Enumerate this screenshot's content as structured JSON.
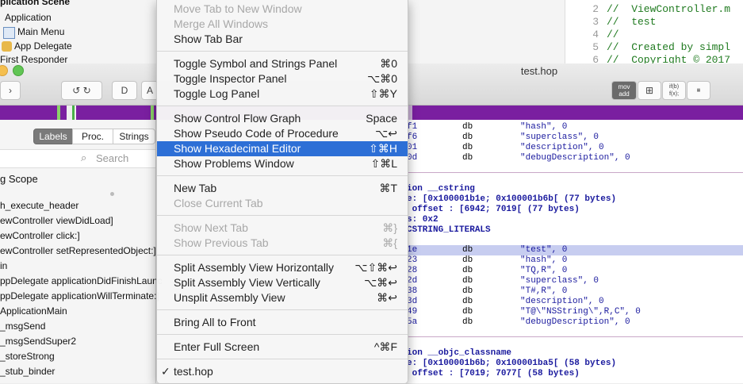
{
  "background": {
    "tree_items": [
      "plication Scene",
      "Application",
      "Main Menu",
      "App Delegate",
      "First Responder"
    ],
    "code_lines": [
      {
        "num": "2",
        "text": "//  ViewController.m"
      },
      {
        "num": "3",
        "text": "//  test"
      },
      {
        "num": "4",
        "text": "//"
      },
      {
        "num": "5",
        "text": "//  Created by simpl"
      },
      {
        "num": "6",
        "text": "//  Copyright © 2017"
      }
    ]
  },
  "hopper": {
    "title": "test.hop",
    "toolbar": {
      "d_label": "D",
      "a_label": "A",
      "mov_label": "mov",
      "add_label": "add",
      "if_label": "if(b)",
      "f_label": "f(x);"
    },
    "tabs": [
      "Labels",
      "Proc.",
      "Strings"
    ],
    "search_placeholder": "Search",
    "scope_title": "g Scope",
    "symbols": [
      "h_execute_header",
      "ewController viewDidLoad]",
      "ewController click:]",
      "ewController setRepresentedObject:]",
      "in",
      "ppDelegate applicationDidFinishLaunc",
      "ppDelegate applicationWillTerminate:]",
      "ApplicationMain",
      "_msgSend",
      "_msgSendSuper2",
      "_storeStrong",
      "_stub_binder"
    ],
    "asm_block1": [
      {
        "a": "f1",
        "b": "db",
        "c": "\"hash\", 0"
      },
      {
        "a": "f6",
        "b": "db",
        "c": "\"superclass\", 0"
      },
      {
        "a": "01",
        "b": "db",
        "c": "\"description\", 0"
      },
      {
        "a": "0d",
        "b": "db",
        "c": "\"debugDescription\", 0"
      }
    ],
    "section1": [
      "ion __cstring",
      "e: [0x100001b1e; 0x100001b6b[ (77 bytes)",
      " offset : [6942; 7019[ (77 bytes)",
      "s: 0x2",
      "CSTRING_LITERALS"
    ],
    "asm_block2": [
      {
        "a": "1e",
        "b": "db",
        "c": "\"test\", 0"
      },
      {
        "a": "23",
        "b": "db",
        "c": "\"hash\", 0"
      },
      {
        "a": "28",
        "b": "db",
        "c": "\"TQ,R\", 0"
      },
      {
        "a": "2d",
        "b": "db",
        "c": "\"superclass\", 0"
      },
      {
        "a": "38",
        "b": "db",
        "c": "\"T#,R\", 0"
      },
      {
        "a": "3d",
        "b": "db",
        "c": "\"description\", 0"
      },
      {
        "a": "49",
        "b": "db",
        "c": "\"T@\\\"NSString\\\",R,C\", 0"
      },
      {
        "a": "5a",
        "b": "db",
        "c": "\"debugDescription\", 0"
      }
    ],
    "section2": [
      "ion __objc_classname",
      "e: [0x100001b6b; 0x100001ba5[ (58 bytes)",
      " offset : [7019; 7077[ (58 bytes)"
    ]
  },
  "menu": {
    "groups": [
      [
        {
          "label": "Move Tab to New Window",
          "shortcut": "",
          "disabled": true
        },
        {
          "label": "Merge All Windows",
          "shortcut": "",
          "disabled": true
        },
        {
          "label": "Show Tab Bar",
          "shortcut": "",
          "disabled": false
        }
      ],
      [
        {
          "label": "Toggle Symbol and Strings Panel",
          "shortcut": "⌘0",
          "disabled": false
        },
        {
          "label": "Toggle Inspector Panel",
          "shortcut": "⌥⌘0",
          "disabled": false
        },
        {
          "label": "Toggle Log Panel",
          "shortcut": "⇧⌘Y",
          "disabled": false
        }
      ],
      [
        {
          "label": "Show Control Flow Graph",
          "shortcut": "Space",
          "disabled": false
        },
        {
          "label": "Show Pseudo Code of Procedure",
          "shortcut": "⌥↩",
          "disabled": false
        },
        {
          "label": "Show Hexadecimal Editor",
          "shortcut": "⇧⌘H",
          "disabled": false,
          "highlighted": true
        },
        {
          "label": "Show Problems Window",
          "shortcut": "⇧⌘L",
          "disabled": false
        }
      ],
      [
        {
          "label": "New Tab",
          "shortcut": "⌘T",
          "disabled": false
        },
        {
          "label": "Close Current Tab",
          "shortcut": "",
          "disabled": true
        }
      ],
      [
        {
          "label": "Show Next Tab",
          "shortcut": "⌘}",
          "disabled": true
        },
        {
          "label": "Show Previous Tab",
          "shortcut": "⌘{",
          "disabled": true
        }
      ],
      [
        {
          "label": "Split Assembly View Horizontally",
          "shortcut": "⌥⇧⌘↩",
          "disabled": false
        },
        {
          "label": "Split Assembly View Vertically",
          "shortcut": "⌥⌘↩",
          "disabled": false
        },
        {
          "label": "Unsplit Assembly View",
          "shortcut": "⌘↩",
          "disabled": false
        }
      ],
      [
        {
          "label": "Bring All to Front",
          "shortcut": "",
          "disabled": false
        }
      ],
      [
        {
          "label": "Enter Full Screen",
          "shortcut": "^⌘F",
          "disabled": false
        }
      ],
      [
        {
          "label": "test.hop",
          "shortcut": "",
          "disabled": false,
          "checked": true
        }
      ]
    ],
    "check_glyph": "✓"
  }
}
